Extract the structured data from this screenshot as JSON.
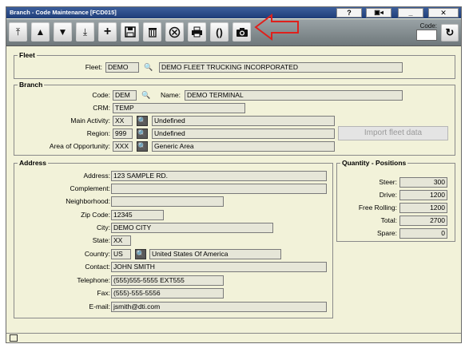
{
  "window": {
    "title": "Branch - Code Maintenance [FCD015]"
  },
  "title_buttons": {
    "help": "?",
    "minimize": "_",
    "close": "✕"
  },
  "toolbar": {
    "buttons": [
      {
        "name": "first-button",
        "icon": "first-icon",
        "glyph": "⏫"
      },
      {
        "name": "prev-button",
        "icon": "prev-icon",
        "glyph": "▲"
      },
      {
        "name": "next-button",
        "icon": "next-icon",
        "glyph": "▼"
      },
      {
        "name": "last-button",
        "icon": "last-icon",
        "glyph": "⏬"
      },
      {
        "name": "add-button",
        "icon": "plus-icon",
        "glyph": "✚"
      },
      {
        "name": "save-button",
        "icon": "floppy-icon",
        "glyph": "💾"
      },
      {
        "name": "delete-button",
        "icon": "trash-icon",
        "glyph": "🗑"
      },
      {
        "name": "cancel-button",
        "icon": "cancel-icon",
        "glyph": "⊗"
      },
      {
        "name": "print-button",
        "icon": "printer-icon",
        "glyph": "⎙"
      },
      {
        "name": "brackets-button",
        "icon": "brackets-icon",
        "glyph": "()"
      },
      {
        "name": "camera-button",
        "icon": "camera-icon",
        "glyph": "📷"
      }
    ],
    "code_label": "Code:",
    "code_value": ""
  },
  "fleet": {
    "legend": "Fleet",
    "label": "Fleet:",
    "code": "DEMO",
    "name": "DEMO FLEET TRUCKING INCORPORATED"
  },
  "branch": {
    "legend": "Branch",
    "code_label": "Code:",
    "code": "DEM",
    "name_label": "Name:",
    "name": "DEMO TERMINAL",
    "crm_label": "CRM:",
    "crm": "TEMP",
    "main_activity_label": "Main Activity:",
    "main_activity_code": "XX",
    "main_activity_desc": "Undefined",
    "region_label": "Region:",
    "region_code": "999",
    "region_desc": "Undefined",
    "area_label": "Area of Opportunity:",
    "area_code": "XXX",
    "area_desc": "Generic Area",
    "import_button": "Import fleet data"
  },
  "address": {
    "legend": "Address",
    "address_label": "Address:",
    "address": "123 SAMPLE RD.",
    "complement_label": "Complement:",
    "complement": "",
    "neighborhood_label": "Neighborhood:",
    "neighborhood": "",
    "zip_label": "Zip Code:",
    "zip": "12345",
    "city_label": "City:",
    "city": "DEMO CITY",
    "state_label": "State:",
    "state": "XX",
    "country_label": "Country:",
    "country_code": "US",
    "country_name": "United States Of America",
    "contact_label": "Contact:",
    "contact": "JOHN SMITH",
    "telephone_label": "Telephone:",
    "telephone": "(555)555-5555 EXT555",
    "fax_label": "Fax:",
    "fax": "(555)-555-5556",
    "email_label": "E-mail:",
    "email": "jsmith@dti.com"
  },
  "quantity": {
    "legend": "Quantity - Positions",
    "steer_label": "Steer:",
    "steer": "300",
    "drive_label": "Drive:",
    "drive": "1200",
    "free_label": "Free Rolling:",
    "free": "1200",
    "total_label": "Total:",
    "total": "2700",
    "spare_label": "Spare:",
    "spare": "0"
  },
  "colors": {
    "accent_arrow": "#e0201b",
    "panel": "#f2f2d9",
    "field": "#e6e6d8"
  }
}
